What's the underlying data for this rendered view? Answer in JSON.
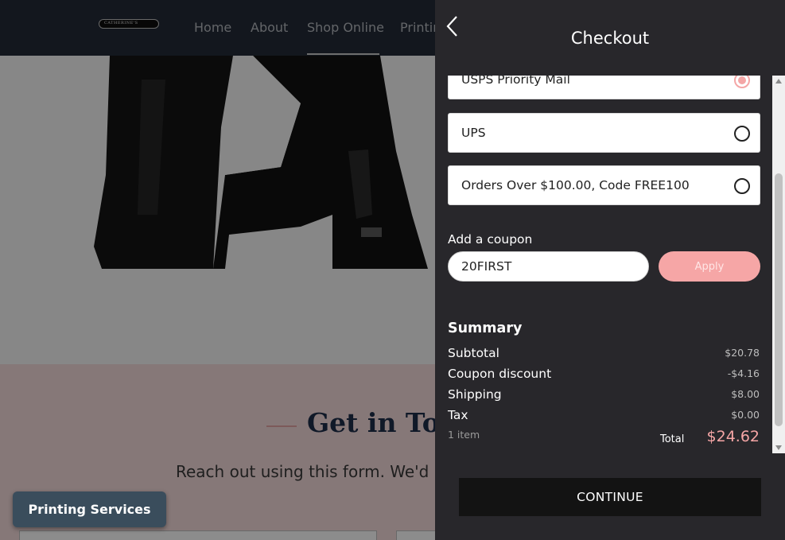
{
  "site": {
    "logo_text": "CATHERINE'S",
    "nav": [
      {
        "label": "Home"
      },
      {
        "label": "About"
      },
      {
        "label": "Shop Online"
      },
      {
        "label": "Printing"
      }
    ],
    "contact_title": "Get in Touch",
    "contact_subtitle": "Reach out using this form. We'd love",
    "printing_button": "Printing Services"
  },
  "checkout": {
    "title": "Checkout",
    "back_icon": "chevron-left-icon",
    "shipping_options": [
      {
        "label": "USPS Priority Mail",
        "selected": true
      },
      {
        "label": "UPS",
        "selected": false
      },
      {
        "label": "Orders Over $100.00, Code FREE100",
        "selected": false
      }
    ],
    "coupon": {
      "label": "Add a coupon",
      "value": "20FIRST",
      "apply_label": "Apply"
    },
    "summary": {
      "title": "Summary",
      "rows": [
        {
          "label": "Subtotal",
          "value": "$20.78"
        },
        {
          "label": "Coupon discount",
          "value": "-$4.16"
        },
        {
          "label": "Shipping",
          "value": "$8.00"
        },
        {
          "label": "Tax",
          "value": "$0.00"
        }
      ],
      "items_count": "1 item",
      "total_label": "Total",
      "total_value": "$24.62"
    },
    "continue_label": "CONTINUE"
  },
  "colors": {
    "panel_bg": "#28272b",
    "accent_pink": "#f6a6a6",
    "header_navy": "#232b38",
    "contact_bg": "#f4dada"
  }
}
